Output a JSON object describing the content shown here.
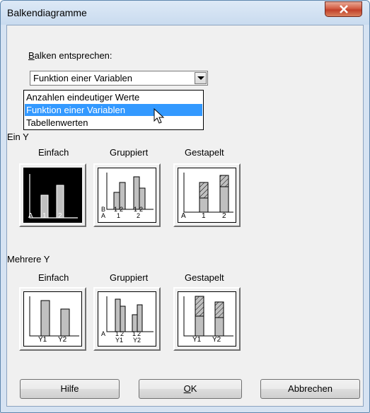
{
  "window": {
    "title": "Balkendiagramme"
  },
  "section": {
    "label_prefix": "B",
    "label_rest": "alken entsprechen:"
  },
  "combo": {
    "selected": "Funktion einer Variablen"
  },
  "dropdown": {
    "options": [
      "Anzahlen eindeutiger Werte",
      "Funktion einer Variablen",
      "Tabellenwerten"
    ],
    "highlighted_index": 1
  },
  "ein_y": {
    "heading": "Ein Y",
    "tiles": [
      {
        "label": "Einfach",
        "selected": true,
        "axis_labels": [
          "A",
          "1",
          "2"
        ]
      },
      {
        "label": "Gruppiert",
        "selected": false,
        "axis_labels": [
          "B",
          "A",
          "1",
          "2",
          "1",
          "2",
          "1",
          "2"
        ]
      },
      {
        "label": "Gestapelt",
        "selected": false,
        "axis_labels": [
          "A",
          "1",
          "2"
        ]
      }
    ]
  },
  "mehrere_y": {
    "heading": "Mehrere Y",
    "tiles": [
      {
        "label": "Einfach",
        "axis_labels": [
          "Y1",
          "Y2"
        ]
      },
      {
        "label": "Gruppiert",
        "axis_labels": [
          "A",
          "1",
          "2",
          "1",
          "2",
          "Y1",
          "Y2"
        ]
      },
      {
        "label": "Gestapelt",
        "axis_labels": [
          "Y1",
          "Y2"
        ]
      }
    ]
  },
  "buttons": {
    "help": "Hilfe",
    "ok_prefix": "O",
    "ok_rest": "K",
    "cancel": "Abbrechen"
  },
  "colors": {
    "selection": "#3399ff",
    "bar_fill": "#c0c0c0",
    "close_button": "#c7452f"
  }
}
